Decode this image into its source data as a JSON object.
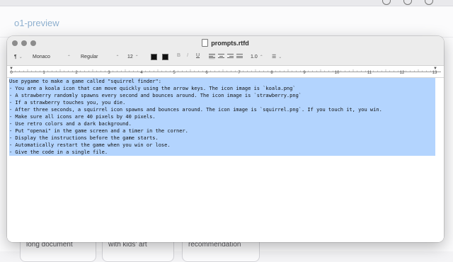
{
  "browser": {
    "page_title": "o1-preview",
    "cards": [
      "long document",
      "with kids' art",
      "recommendation"
    ]
  },
  "window": {
    "title": "prompts.rtfd",
    "toolbar": {
      "paragraph": "¶",
      "font_family": "Monaco",
      "font_style": "Regular",
      "font_size": "12",
      "bold": "B",
      "italic": "I",
      "underline": "U",
      "line_spacing": "1.0",
      "list_style": "☰"
    },
    "ruler": {
      "numbers": [
        "0",
        "1",
        "2",
        "3",
        "4",
        "5",
        "6",
        "7",
        "8",
        "9",
        "10",
        "11",
        "12",
        "13"
      ]
    },
    "selection_color": "#b3d4fe",
    "lines": [
      "Use pygame to make a game called \"squirrel finder\":",
      "- You are a koala icon that can move quickly using the arrow keys. The icon image is `koala.png`",
      "- A strawberry randomly spawns every second and bounces around. The icon image is `strawberry.png`",
      "- If a strawberry touches you, you die.",
      "- After three seconds, a squirrel icon spawns and bounces around. The icon image is `squirrel.png`. If you touch it, you win.",
      "- Make sure all icons are 40 pixels by 40 pixels.",
      "- Use retro colors and a dark background.",
      "- Put \"openai\" in the game screen and a timer in the corner.",
      "- Display the instructions before the game starts.",
      "- Automatically restart the game when you win or lose.",
      "- Give the code in a single file."
    ]
  }
}
